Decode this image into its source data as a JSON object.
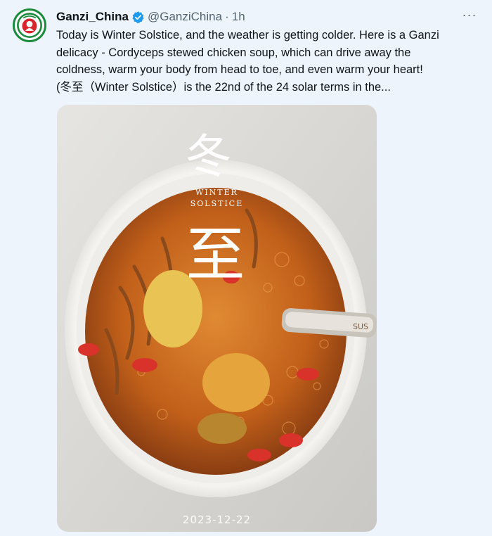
{
  "post": {
    "display_name": "Ganzi_China",
    "handle": "@GanziChina",
    "separator": "·",
    "time": "1h",
    "more_label": "···",
    "text_lines": [
      "Today is Winter Solstice, and the weather is getting colder. Here is a Ganzi",
      "delicacy - Cordyceps stewed chicken soup, which can drive away the",
      "coldness, warm your body from head to toe, and even warm your heart!",
      "(冬至（Winter Solstice）is the 22nd of the 24 solar terms in the..."
    ]
  },
  "media": {
    "title_char_1": "冬",
    "title_char_2": "至",
    "caption_line_1": "WINTER",
    "caption_line_2": "SOLSTICE",
    "spoon_text": "SUS",
    "date": "2023-12-22"
  },
  "colors": {
    "background": "#eef4fb",
    "verified_blue": "#1d9bf0",
    "avatar_green": "#1a8a3c",
    "soup": "#c9661c"
  },
  "icons": {
    "verified": "verified-badge-icon",
    "more": "more-options-icon",
    "avatar": "ganzi-logo-avatar"
  }
}
